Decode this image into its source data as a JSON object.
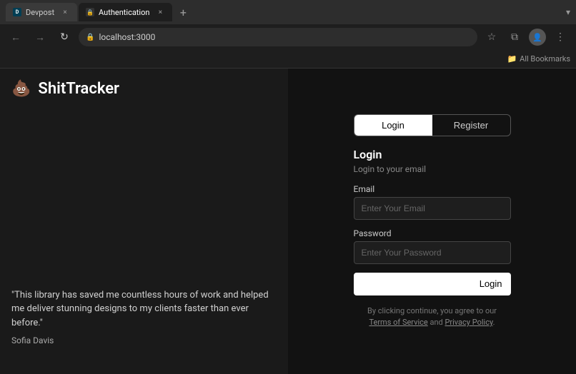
{
  "browser": {
    "tabs": [
      {
        "id": "devpost",
        "label": "Devpost",
        "active": false,
        "favicon": "D"
      },
      {
        "id": "auth",
        "label": "Authentication",
        "active": true,
        "favicon": "🔒"
      }
    ],
    "new_tab_label": "+",
    "expand_label": "▾",
    "address": "localhost:3000",
    "nav": {
      "back": "←",
      "forward": "→",
      "reload": "↻"
    },
    "actions": {
      "star": "☆",
      "extensions": "⧉",
      "profile": "👤",
      "menu": "⋮"
    },
    "bookmarks_label": "All Bookmarks",
    "bookmarks_icon": "📁"
  },
  "app": {
    "icon": "💩",
    "title": "ShitTracker"
  },
  "auth": {
    "tabs": [
      {
        "id": "login",
        "label": "Login",
        "active": true
      },
      {
        "id": "register",
        "label": "Register",
        "active": false
      }
    ],
    "form_title": "Login",
    "form_subtitle": "Login to your email",
    "email_label": "Email",
    "email_placeholder": "Enter Your Email",
    "password_label": "Password",
    "password_placeholder": "Enter Your Password",
    "login_button": "Login",
    "terms_prefix": "By clicking continue, you agree to our",
    "terms_link": "Terms of Service",
    "terms_and": "and",
    "privacy_link": "Privacy Policy",
    "terms_suffix": "."
  },
  "testimonial": {
    "quote": "\"This library has saved me countless hours of work and helped me deliver stunning designs to my clients faster than ever before.\"",
    "author": "Sofia Davis"
  }
}
